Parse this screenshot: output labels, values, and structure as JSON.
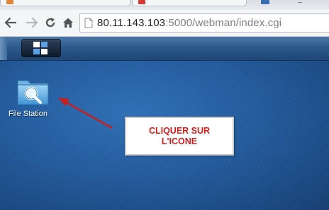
{
  "browser": {
    "url_main": "80.11.143.103",
    "url_rest": ":5000/webman/index.cgi",
    "window_minimize_glyph": "–",
    "icons": [
      "back-arrow-icon",
      "forward-arrow-icon",
      "reload-icon",
      "home-icon",
      "page-icon"
    ]
  },
  "taskbar": {
    "main_menu_icon": "main-menu-grid-icon"
  },
  "desktop": {
    "icons": [
      {
        "label": "File Station",
        "icon": "file-station-folder-icon"
      }
    ],
    "annotation": {
      "text": "CLIQUER SUR\nL'ICONE",
      "color": "#d11f1f"
    }
  },
  "colors": {
    "desktop_blue": "#235b9c",
    "taskbar_blue": "#2d5a8c",
    "annotation_red": "#d11f1f"
  }
}
